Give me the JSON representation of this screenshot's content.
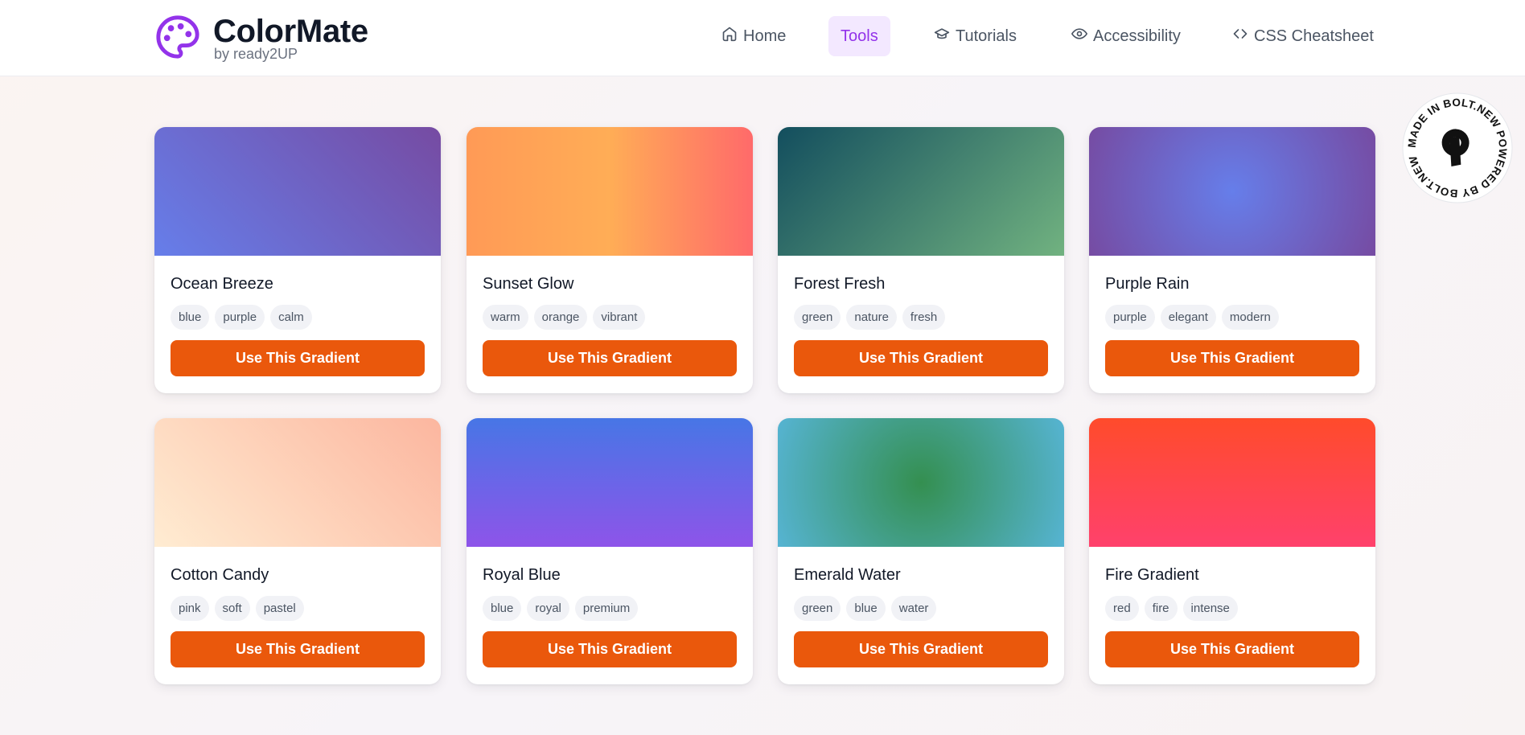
{
  "brand": {
    "title": "ColorMate",
    "subtitle": "by ready2UP",
    "icon": "palette-icon",
    "color": "#9333ea"
  },
  "nav": [
    {
      "label": "Home",
      "icon": "home-icon",
      "active": false
    },
    {
      "label": "Tools",
      "icon": "",
      "active": true
    },
    {
      "label": "Tutorials",
      "icon": "graduation-cap-icon",
      "active": false
    },
    {
      "label": "Accessibility",
      "icon": "eye-icon",
      "active": false
    },
    {
      "label": "CSS Cheatsheet",
      "icon": "code-icon",
      "active": false
    }
  ],
  "badge": {
    "text": "MADE IN BOLT.NEW POWERED BY BOLT.NEW "
  },
  "button_color": "#ea580c",
  "cards": [
    {
      "name": "Ocean Breeze",
      "tags": [
        "blue",
        "purple",
        "calm"
      ],
      "button": "Use This Gradient",
      "gradient": "linear-gradient(45deg, #667eea 0%, #764ba2 100%)"
    },
    {
      "name": "Sunset Glow",
      "tags": [
        "warm",
        "orange",
        "vibrant"
      ],
      "button": "Use This Gradient",
      "gradient": "linear-gradient(90deg, #ff9a56 0%, #ffad56 50%, #ff6a6a 100%)"
    },
    {
      "name": "Forest Fresh",
      "tags": [
        "green",
        "nature",
        "fresh"
      ],
      "button": "Use This Gradient",
      "gradient": "linear-gradient(135deg, #134e5e 0%, #71b280 100%)"
    },
    {
      "name": "Purple Rain",
      "tags": [
        "purple",
        "elegant",
        "modern"
      ],
      "button": "Use This Gradient",
      "gradient": "radial-gradient(circle at 50% 50%, #667eea 0%, #764ba2 100%)"
    },
    {
      "name": "Cotton Candy",
      "tags": [
        "pink",
        "soft",
        "pastel"
      ],
      "button": "Use This Gradient",
      "gradient": "linear-gradient(45deg, #ffecd2 0%, #fcb69f 100%)"
    },
    {
      "name": "Royal Blue",
      "tags": [
        "blue",
        "royal",
        "premium"
      ],
      "button": "Use This Gradient",
      "gradient": "linear-gradient(0deg, #8e54e9 0%, #4776e6 100%)"
    },
    {
      "name": "Emerald Water",
      "tags": [
        "green",
        "blue",
        "water"
      ],
      "button": "Use This Gradient",
      "gradient": "radial-gradient(circle at 50% 50%, #348f50 0%, #56b4d3 100%)"
    },
    {
      "name": "Fire Gradient",
      "tags": [
        "red",
        "fire",
        "intense"
      ],
      "button": "Use This Gradient",
      "gradient": "linear-gradient(0deg, #ff416c 0%, #ff4b2b 100%)"
    }
  ]
}
